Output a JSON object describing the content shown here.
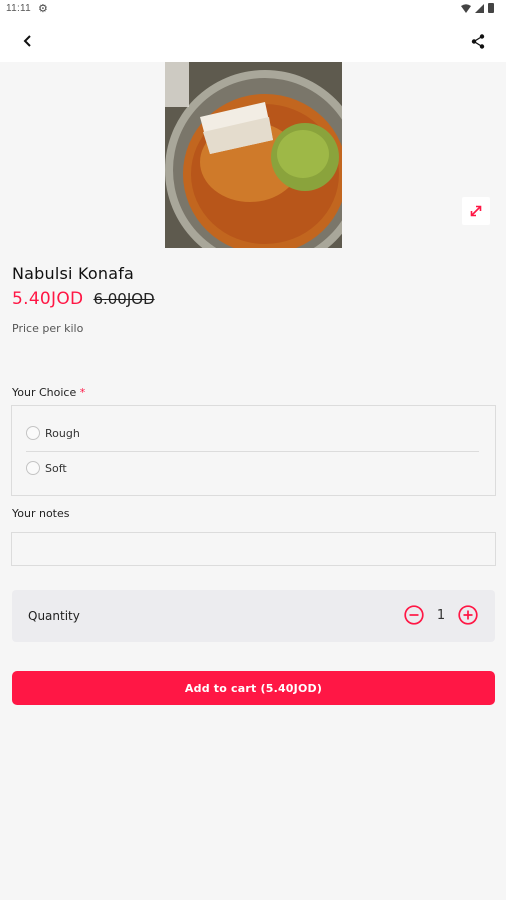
{
  "status_bar": {
    "time": "11:11",
    "settings_icon": "gear-icon",
    "wifi_icon": "wifi-icon",
    "signal_icon": "signal-icon",
    "battery_icon": "battery-icon"
  },
  "app_bar": {
    "back_icon": "arrow-back-icon",
    "share_icon": "share-icon"
  },
  "product": {
    "name": "Nabulsi Konafa",
    "price": "5.40JOD",
    "old_price": "6.00JOD",
    "unit_note": "Price per kilo",
    "expand_icon": "expand-diagonal-icon",
    "accent_color": "#ff1745"
  },
  "choice": {
    "label": "Your Choice",
    "required_mark": "*",
    "options": [
      {
        "label": "Rough",
        "selected": false
      },
      {
        "label": "Soft",
        "selected": false
      }
    ]
  },
  "notes": {
    "label": "Your notes",
    "value": "",
    "placeholder": ""
  },
  "quantity": {
    "label": "Quantity",
    "value": "1",
    "minus_icon": "minus-circle-icon",
    "plus_icon": "plus-circle-icon"
  },
  "cart_button": {
    "label": "Add to cart (5.40JOD)"
  }
}
